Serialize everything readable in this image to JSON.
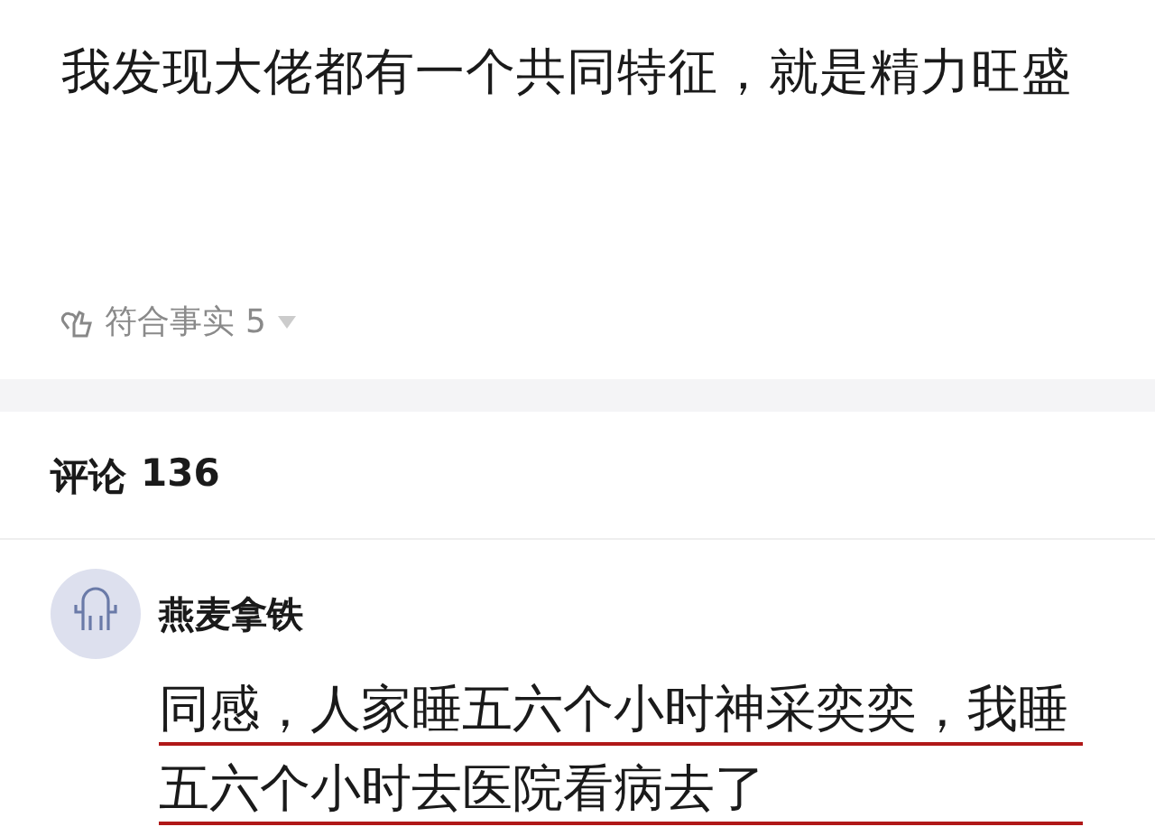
{
  "post": {
    "title": "我发现大佬都有一个共同特征，就是精力旺盛",
    "reaction": {
      "label": "符合事实",
      "count": "5",
      "expanded": false
    }
  },
  "comments_header": {
    "label": "评论",
    "count": "136"
  },
  "comments": [
    {
      "author": "燕麦拿铁",
      "text": "同感，人家睡五六个小时神采奕奕，我睡五六个小时去医院看病去了",
      "underlined": true
    }
  ]
}
